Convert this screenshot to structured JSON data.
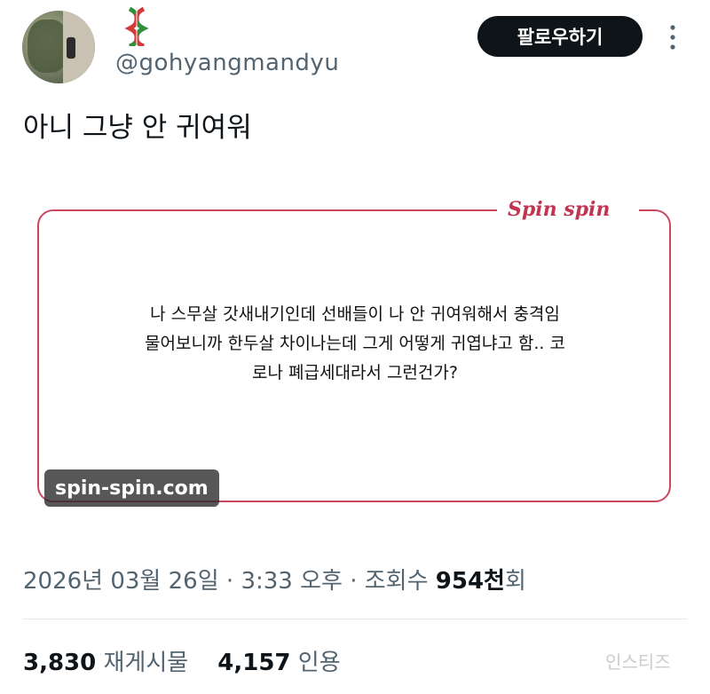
{
  "post": {
    "handle": "@gohyangmandyu",
    "follow_label": "팔로우하기",
    "text": "아니 그냥 안 귀여워"
  },
  "card": {
    "brand": "Spin spin",
    "lines": [
      "나 스무살 갓새내기인데 선배들이 나 안 귀여워해서 충격임",
      "물어보니까 한두살 차이나는데 그게 어떻게 귀엽냐고 함.. 코",
      "로나 폐급세대라서 그런건가?"
    ],
    "watermark": "spin-spin.com"
  },
  "meta": {
    "date": "2026년 03월 26일",
    "sep1": "·",
    "time": "3:33 오후",
    "sep2": "·",
    "views_label": "조회수",
    "views_value": "954천",
    "views_unit": "회"
  },
  "stats": {
    "reposts_count": "3,830",
    "reposts_label": "재게시물",
    "quotes_count": "4,157",
    "quotes_label": "인용"
  },
  "site_watermark": "인스티즈",
  "icons": {
    "more": "more-vertical-icon",
    "name_emoji": "braid-emoji-icon"
  },
  "colors": {
    "card_border": "#c9485f",
    "brand": "#c2344f",
    "follow_bg": "#0f1419",
    "secondary_text": "#536471"
  }
}
